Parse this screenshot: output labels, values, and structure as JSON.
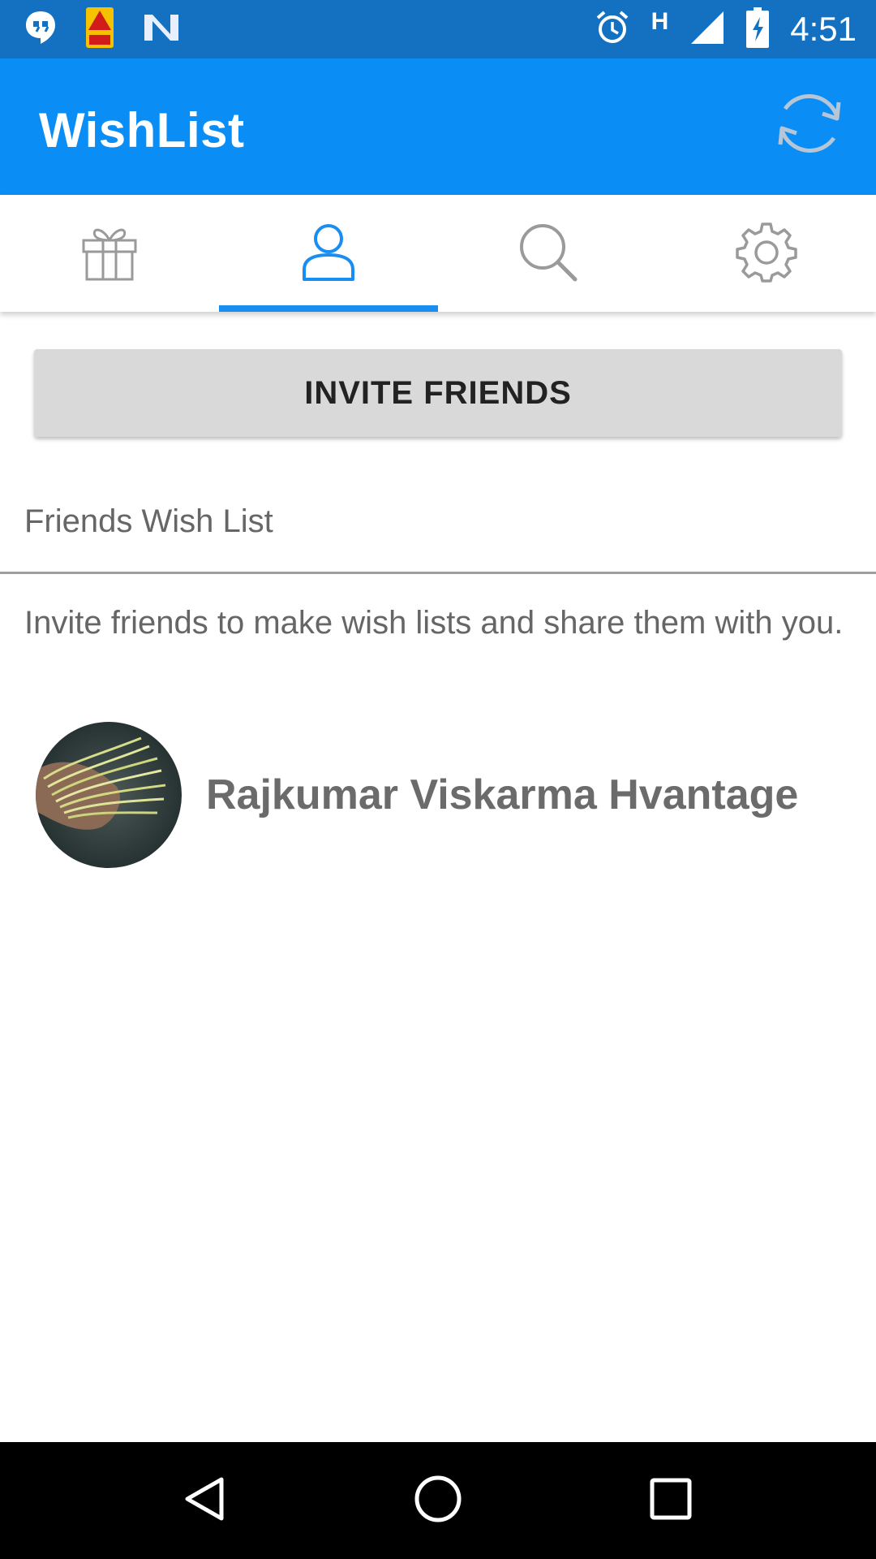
{
  "status_bar": {
    "time": "4:51",
    "network_label": "H",
    "notification_icons": [
      "hangouts-icon",
      "abp-live-app-icon",
      "n-app-icon"
    ],
    "system_icons": [
      "alarm-icon",
      "signal-icon",
      "battery-charging-icon"
    ],
    "background_color": "#1470c0"
  },
  "app_bar": {
    "title": "WishList",
    "action_icon": "refresh-icon",
    "background_color": "#0a8ef5"
  },
  "tabs": [
    {
      "icon": "gift-icon",
      "selected": false
    },
    {
      "icon": "person-icon",
      "selected": true
    },
    {
      "icon": "search-icon",
      "selected": false
    },
    {
      "icon": "gear-icon",
      "selected": false
    }
  ],
  "accent_color": "#1a8df0",
  "invite_button": {
    "label": "INVITE FRIENDS"
  },
  "friends_section": {
    "title": "Friends Wish List",
    "info": "Invite friends to make wish lists and share them with you.",
    "friends": [
      {
        "name": "Rajkumar Viskarma Hvantage",
        "avatar_icon": "avatar-photo"
      }
    ]
  },
  "nav_bar": {
    "buttons": [
      "back-icon",
      "home-icon",
      "recents-icon"
    ]
  }
}
